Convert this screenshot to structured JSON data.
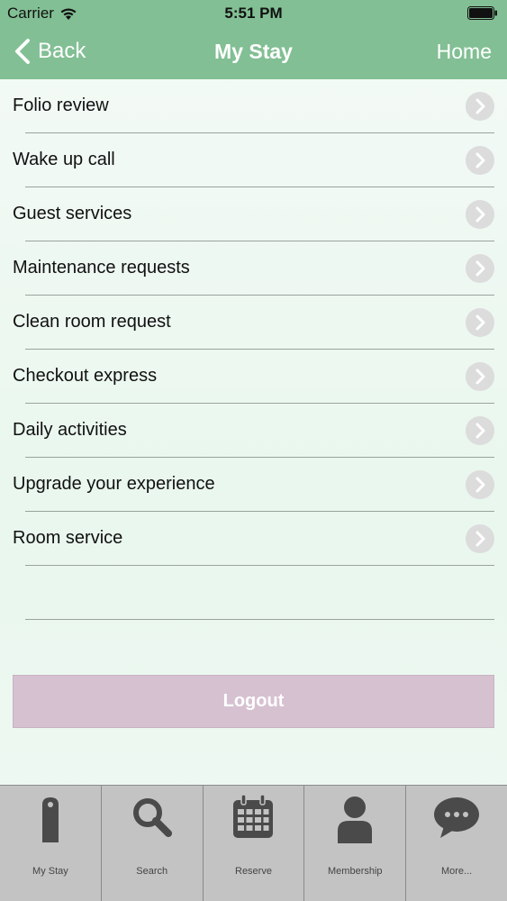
{
  "status_bar": {
    "carrier": "Carrier",
    "time": "5:51 PM"
  },
  "navbar": {
    "back_label": "Back",
    "title": "My Stay",
    "home_label": "Home"
  },
  "menu": {
    "items": [
      {
        "label": "Folio review"
      },
      {
        "label": "Wake up call"
      },
      {
        "label": "Guest services"
      },
      {
        "label": "Maintenance requests"
      },
      {
        "label": "Clean room request"
      },
      {
        "label": "Checkout express"
      },
      {
        "label": "Daily activities"
      },
      {
        "label": "Upgrade your experience"
      },
      {
        "label": "Room service"
      }
    ]
  },
  "logout_label": "Logout",
  "tabs": [
    {
      "label": "My Stay",
      "icon": "tag-icon"
    },
    {
      "label": "Search",
      "icon": "search-icon"
    },
    {
      "label": "Reserve",
      "icon": "calendar-icon"
    },
    {
      "label": "Membership",
      "icon": "person-icon"
    },
    {
      "label": "More...",
      "icon": "chat-bubble-icon"
    }
  ],
  "colors": {
    "header": "#82bf94",
    "logout_button": "#d6c1d1",
    "tabbar": "#c3c3c3",
    "icon": "#4a4a4a"
  }
}
